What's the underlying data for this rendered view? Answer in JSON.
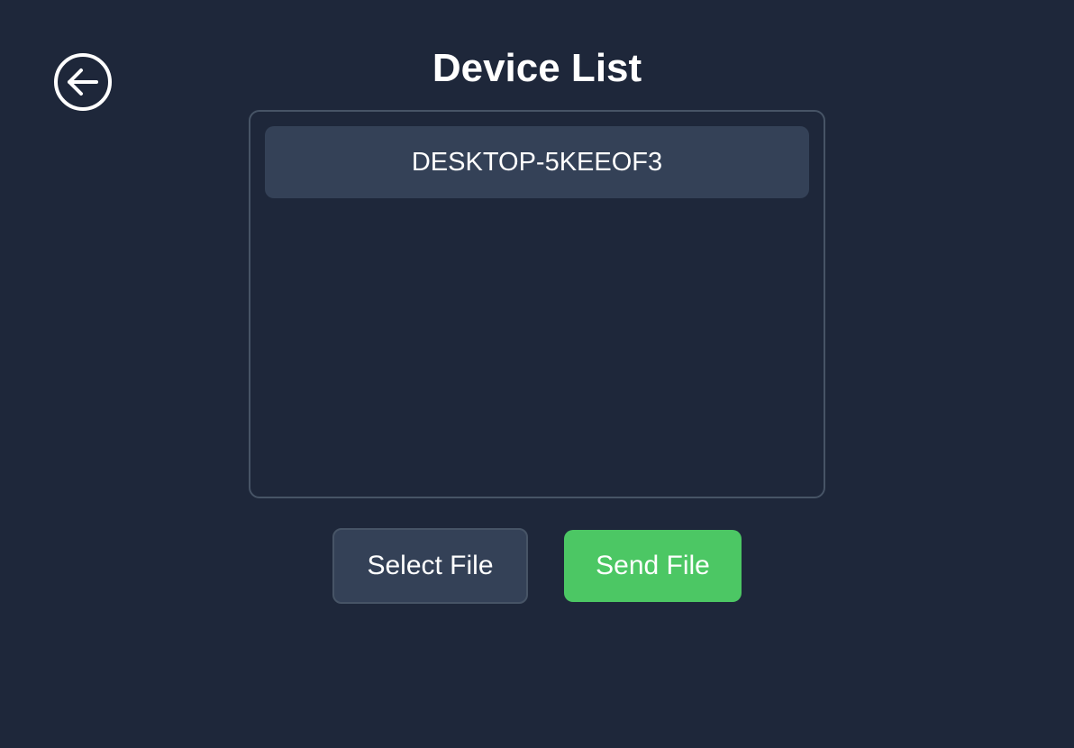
{
  "header": {
    "title": "Device List",
    "back_icon": "arrow-left-circle-icon"
  },
  "devices": [
    {
      "name": "DESKTOP-5KEEOF3"
    }
  ],
  "actions": {
    "select_file_label": "Select File",
    "send_file_label": "Send File"
  },
  "colors": {
    "background": "#1e273a",
    "panel_border": "#475466",
    "item_background": "#344157",
    "send_button": "#4cc764",
    "text": "#ffffff"
  }
}
